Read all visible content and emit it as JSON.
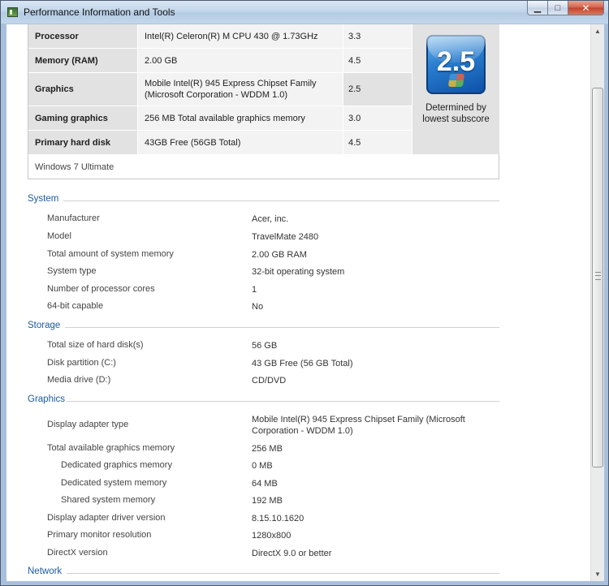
{
  "window": {
    "title": "Performance Information and Tools"
  },
  "window_controls": {
    "minimize": "▁",
    "maximize": "□",
    "close": "✕"
  },
  "scores": {
    "rows": [
      {
        "component": "Processor",
        "detail": "Intel(R) Celeron(R) M CPU 430 @ 1.73GHz",
        "subscore": "3.3"
      },
      {
        "component": "Memory (RAM)",
        "detail": "2.00 GB",
        "subscore": "4.5"
      },
      {
        "component": "Graphics",
        "detail": "Mobile Intel(R) 945 Express Chipset Family (Microsoft Corporation - WDDM 1.0)",
        "subscore": "2.5"
      },
      {
        "component": "Gaming graphics",
        "detail": "256 MB Total available graphics memory",
        "subscore": "3.0"
      },
      {
        "component": "Primary hard disk",
        "detail": "43GB Free (56GB Total)",
        "subscore": "4.5"
      }
    ],
    "base_score": "2.5",
    "base_note": "Determined by lowest subscore",
    "edition": "Windows 7 Ultimate"
  },
  "system": {
    "heading": "System",
    "rows": [
      {
        "label": "Manufacturer",
        "value": "Acer, inc."
      },
      {
        "label": "Model",
        "value": "TravelMate 2480"
      },
      {
        "label": "Total amount of system memory",
        "value": "2.00 GB RAM"
      },
      {
        "label": "System type",
        "value": "32-bit operating system"
      },
      {
        "label": "Number of processor cores",
        "value": "1"
      },
      {
        "label": "64-bit capable",
        "value": "No"
      }
    ]
  },
  "storage": {
    "heading": "Storage",
    "rows": [
      {
        "label": "Total size of hard disk(s)",
        "value": "56 GB"
      },
      {
        "label": "Disk partition (C:)",
        "value": "43 GB Free (56 GB Total)"
      },
      {
        "label": "Media drive (D:)",
        "value": "CD/DVD"
      }
    ]
  },
  "graphics": {
    "heading": "Graphics",
    "rows": [
      {
        "label": "Display adapter type",
        "value": "Mobile Intel(R) 945 Express Chipset Family (Microsoft Corporation - WDDM 1.0)"
      },
      {
        "label": "Total available graphics memory",
        "value": "256 MB"
      },
      {
        "label": "Dedicated graphics memory",
        "value": "0 MB"
      },
      {
        "label": "Dedicated system memory",
        "value": "64 MB"
      },
      {
        "label": "Shared system memory",
        "value": "192 MB"
      },
      {
        "label": "Display adapter driver version",
        "value": "8.15.10.1620"
      },
      {
        "label": "Primary monitor resolution",
        "value": "1280x800"
      },
      {
        "label": "DirectX version",
        "value": "DirectX 9.0 or better"
      }
    ]
  },
  "network": {
    "heading": "Network"
  },
  "colors": {
    "section_heading": "#1e5aa0",
    "score_badge": "#2a7fd0"
  }
}
